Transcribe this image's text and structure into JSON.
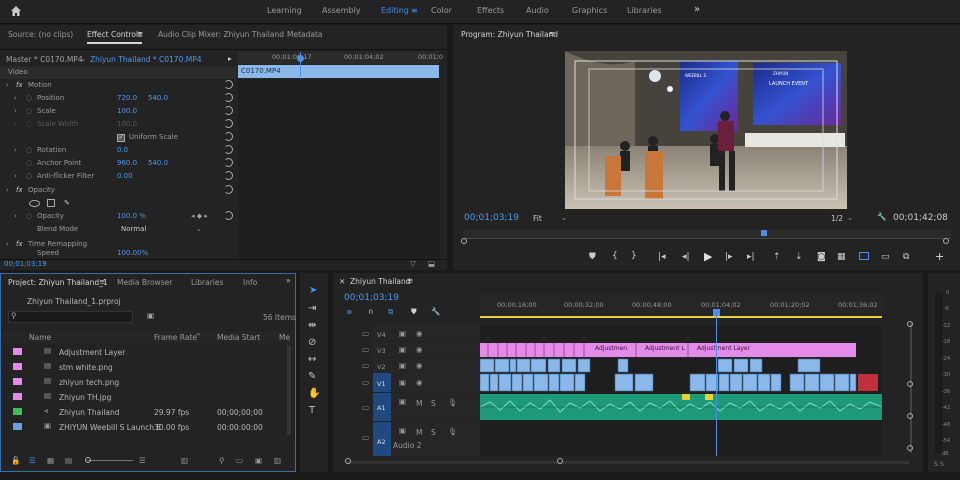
{
  "workspaces": [
    "Learning",
    "Assembly",
    "Editing",
    "Color",
    "Effects",
    "Audio",
    "Graphics",
    "Libraries"
  ],
  "workspace_more": "»",
  "source_panel": {
    "tabs": [
      "Source: (no clips)",
      "Effect Controls",
      "Audio Clip Mixer: Zhiyun Thailand",
      "Metadata"
    ],
    "menu_icon": "≡",
    "master": "Master * C0170.MP4",
    "sequence_clip": "Zhiyun Thailand * C0170.MP4",
    "ruler": [
      "00;01;00;17",
      "00;01;04;02",
      "00;01;0"
    ],
    "clip_label": "C0170.MP4",
    "section_video": "Video",
    "motion": "Motion",
    "position_label": "Position",
    "position_x": "720.0",
    "position_y": "540.0",
    "scale_label": "Scale",
    "scale_value": "100.0",
    "scale_width_label": "Scale Width",
    "scale_width_value": "100.0",
    "uniform_scale": "Uniform Scale",
    "rotation_label": "Rotation",
    "rotation_value": "0.0",
    "anchor_label": "Anchor Point",
    "anchor_x": "960.0",
    "anchor_y": "540.0",
    "antiflicker_label": "Anti-flicker Filter",
    "antiflicker_value": "0.00",
    "opacity": "Opacity",
    "opacity_label": "Opacity",
    "opacity_value": "100.0 %",
    "blend_label": "Blend Mode",
    "blend_value": "Normal",
    "time_remap": "Time Remapping",
    "speed_label": "Speed",
    "speed_value": "100.00%",
    "timecode": "00;01;03;19"
  },
  "program": {
    "title": "Program: Zhiyun Thailand",
    "timecode": "00;01;03;19",
    "fit": "Fit",
    "resolution": "1/2",
    "duration": "00;01;42;08",
    "screen_text": [
      "WEEBILL S",
      "LAUNCH EVENT",
      "ZHIYUN"
    ]
  },
  "project": {
    "tabs": [
      "Project: Zhiyun Thailand_1",
      "Media Browser",
      "Libraries",
      "Info"
    ],
    "file": "Zhiyun Thailand_1.prproj",
    "items_count": "56 Items",
    "columns": [
      "Name",
      "Frame Rate",
      "Media Start",
      "Me"
    ],
    "items": [
      {
        "name": "Adjustment Layer",
        "fps": "",
        "start": "",
        "color": "#e48ae8"
      },
      {
        "name": "stm white.png",
        "fps": "",
        "start": "",
        "color": "#e48ae8"
      },
      {
        "name": "zhiyun tech.png",
        "fps": "",
        "start": "",
        "color": "#e48ae8"
      },
      {
        "name": "Zhiyun TH.jpg",
        "fps": "",
        "start": "",
        "color": "#e48ae8"
      },
      {
        "name": "Zhiyun Thailand",
        "fps": "29.97 fps",
        "start": "00;00;00;00",
        "color": "#3fbf5a"
      },
      {
        "name": "ZHIYUN Weebill S Launch E",
        "fps": "30.00 fps",
        "start": "00:00:00:00",
        "color": "#6ba0e0"
      }
    ]
  },
  "timeline": {
    "title": "Zhiyun Thailand",
    "timecode": "00;01;03;19",
    "ruler": [
      "00;00;16;00",
      "00;00;32;00",
      "00;00;48;00",
      "00;01;04;02",
      "00;01;20;02",
      "00;01;36;02"
    ],
    "tracks": [
      "V4",
      "V3",
      "V2",
      "V1",
      "A1",
      "A2"
    ],
    "audio2_name": "Audio 2",
    "adjustment_labels": [
      "Adjustmen",
      "Adjustment L",
      "Adjustment Layer"
    ],
    "m": "M",
    "s": "S"
  },
  "meter": [
    "0",
    "-6",
    "-12",
    "-18",
    "-24",
    "-30",
    "-36",
    "-42",
    "-48",
    "-54",
    "dB"
  ],
  "meter_labels": [
    "S",
    "S"
  ]
}
